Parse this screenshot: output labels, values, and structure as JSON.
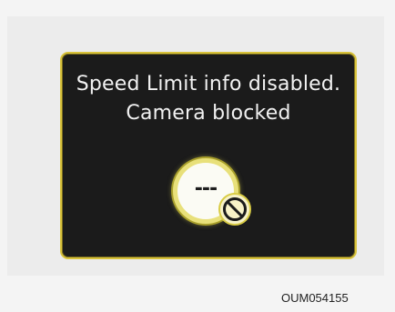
{
  "display": {
    "message_line_1": "Speed Limit info disabled.",
    "message_line_2": "Camera blocked",
    "speed_sign_value": "---",
    "icons": {
      "speed_sign": "speed-limit-sign-icon",
      "blocked": "prohibited-icon"
    },
    "colors": {
      "screen_background": "#1b1b1b",
      "screen_border": "#d8c23b",
      "text": "#f2f2f2",
      "sign_ring": "#e8e07a"
    }
  },
  "caption": {
    "code": "OUM054155"
  }
}
